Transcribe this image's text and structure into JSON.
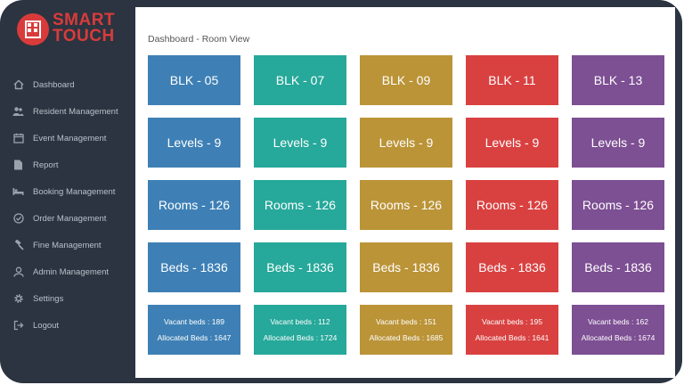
{
  "brand": {
    "line1": "SMART",
    "line2": "TOUCH"
  },
  "sidebar": {
    "items": [
      {
        "label": "Dashboard",
        "icon": "home-icon"
      },
      {
        "label": "Resident Management",
        "icon": "users-icon"
      },
      {
        "label": "Event Management",
        "icon": "calendar-icon"
      },
      {
        "label": "Report",
        "icon": "document-icon"
      },
      {
        "label": "Booking Management",
        "icon": "bed-icon"
      },
      {
        "label": "Order Management",
        "icon": "check-circle-icon"
      },
      {
        "label": "Fine Management",
        "icon": "gavel-icon"
      },
      {
        "label": "Admin Management",
        "icon": "user-icon"
      },
      {
        "label": "Settings",
        "icon": "gear-icon"
      },
      {
        "label": "Logout",
        "icon": "logout-icon"
      }
    ]
  },
  "main": {
    "breadcrumb": "Dashboard - Room View",
    "blocks": [
      {
        "name": "BLK - 05",
        "levels": "Levels - 9",
        "rooms": "Rooms - 126",
        "beds": "Beds - 1836",
        "vacant": "Vacant beds : 189",
        "allocated": "Allocated Beds : 1647"
      },
      {
        "name": "BLK - 07",
        "levels": "Levels - 9",
        "rooms": "Rooms - 126",
        "beds": "Beds - 1836",
        "vacant": "Vacant beds : 112",
        "allocated": "Allocated Beds : 1724"
      },
      {
        "name": "BLK - 09",
        "levels": "Levels - 9",
        "rooms": "Rooms - 126",
        "beds": "Beds - 1836",
        "vacant": "Vacant beds : 151",
        "allocated": "Allocated Beds : 1685"
      },
      {
        "name": "BLK - 11",
        "levels": "Levels - 9",
        "rooms": "Rooms - 126",
        "beds": "Beds - 1836",
        "vacant": "Vacant beds : 195",
        "allocated": "Allocated Beds : 1641"
      },
      {
        "name": "BLK - 13",
        "levels": "Levels - 9",
        "rooms": "Rooms - 126",
        "beds": "Beds - 1836",
        "vacant": "Vacant beds : 162",
        "allocated": "Allocated Beds : 1674"
      }
    ]
  },
  "colors": {
    "blue": "#3e80b5",
    "teal": "#26a89a",
    "gold": "#bb9438",
    "red": "#d94141",
    "purple": "#7d4f93",
    "sidebar": "#2b3440",
    "brand": "#d93b3b"
  }
}
